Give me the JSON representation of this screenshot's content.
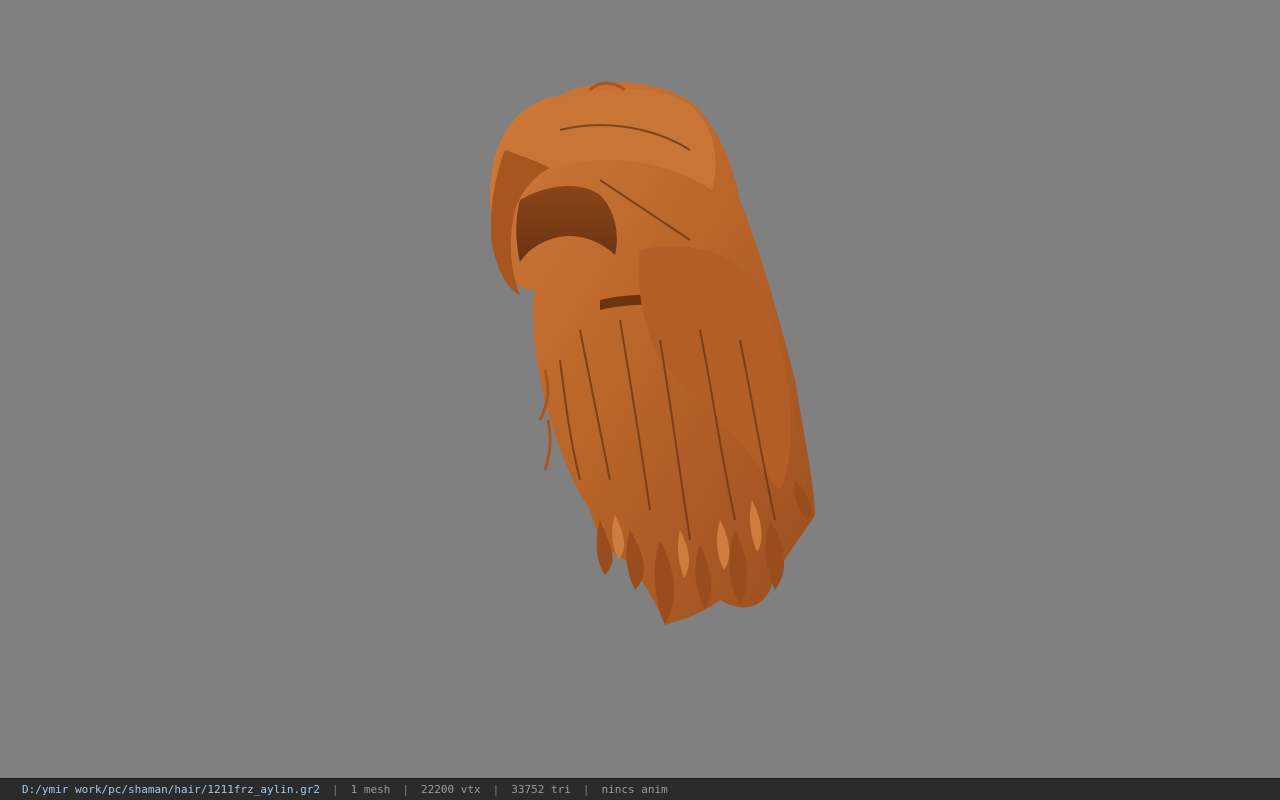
{
  "viewport": {
    "background_color": "#808080",
    "model_color": "#b8642a",
    "model_shadow_color": "#7a3c14",
    "model_highlight_color": "#d58445"
  },
  "statusbar": {
    "file_path": "D:/ymir work/pc/shaman/hair/1211frz_aylin.gr2",
    "separator": "|",
    "mesh_count": "1 mesh",
    "vertex_count": "22200 vtx",
    "triangle_count": "33752 tri",
    "animation": "nincs anim"
  }
}
